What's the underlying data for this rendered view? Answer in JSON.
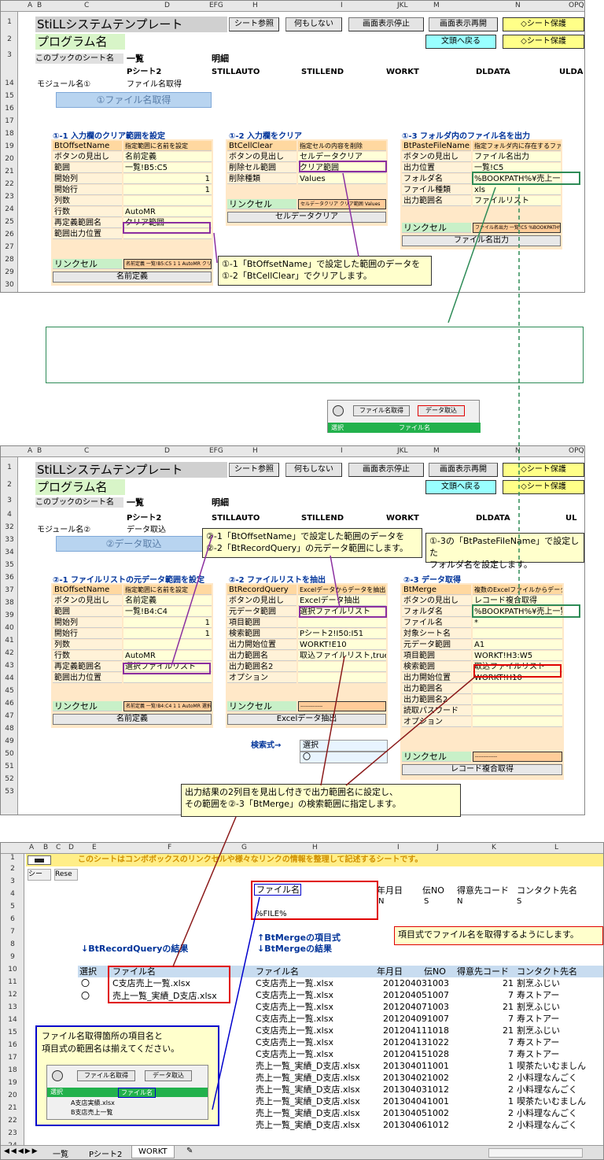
{
  "colors": {
    "accent": "#8b2fa0",
    "green": "#2e8b57",
    "red": "#e00000",
    "blue": "#0000cc"
  },
  "hdr": {
    "cols": [
      "A",
      "B",
      "C",
      "D",
      "EFG",
      "H",
      "I",
      "JKL",
      "M",
      "N",
      "OPQ"
    ],
    "title": "StiLLシステムテンプレート",
    "prog": "プログラム名",
    "btn_sheet": "シート参照",
    "btn_none": "何もしない",
    "btn_stop": "画面表示停止",
    "btn_resume": "画面表示再開",
    "btn_protect": "◇シート保護",
    "btn_back": "文頭へ戻る",
    "r3_label": "このブックのシート名",
    "r3_a": "一覧",
    "r3_b": "明細",
    "r4": [
      "Pシート2",
      "STILLAUTO",
      "STILLEND",
      "WORKT",
      "DLDATA",
      "ULDA"
    ],
    "r4b": [
      "Pシート2",
      "STILLAUTO",
      "STILLEND",
      "WORKT",
      "DLDATA",
      "UL"
    ]
  },
  "s1": {
    "rows": [
      "1",
      "2",
      "3",
      "14",
      "15",
      "16",
      "17",
      "18",
      "19",
      "20",
      "21",
      "22",
      "23",
      "24",
      "25",
      "26",
      "27",
      "28",
      "29",
      "30",
      "31"
    ],
    "module_label": "モジュール名①",
    "module_value": "ファイル名取得",
    "band": "①ファイル名取得",
    "sec1": "①-1 入力欄のクリア範囲を設定",
    "sec2": "①-2 入力欄をクリア",
    "sec3": "①-3 フォルダ内のファイル名を出力",
    "p1": [
      [
        "BtOffsetName",
        "指定範囲に名前を設定"
      ],
      [
        "ボタンの見出し",
        "名前定義"
      ],
      [
        "範囲",
        "一覧!B5:C5"
      ],
      [
        "開始列",
        "1"
      ],
      [
        "開始行",
        "1"
      ],
      [
        "列数",
        ""
      ],
      [
        "行数",
        "AutoMR"
      ],
      [
        "再定義範囲名",
        "クリア範囲"
      ],
      [
        "範囲出力位置",
        ""
      ]
    ],
    "p1_link": "リンクセル",
    "p1_linkv": "名前定義 一覧!B5:C5 1 1 AutoMR クリア範囲",
    "p1_btn": "名前定義",
    "p2": [
      [
        "BtCellClear",
        "指定セルの内容を削除"
      ],
      [
        "ボタンの見出し",
        "セルデータクリア"
      ],
      [
        "削除セル範囲",
        "クリア範囲"
      ],
      [
        "削除種類",
        "Values"
      ]
    ],
    "p2_link": "リンクセル",
    "p2_linkv": "セルデータクリア クリア範囲 Values",
    "p2_btn": "セルデータクリア",
    "p3": [
      [
        "BtPasteFileName",
        "指定フォルダ内に存在するファイル名をセルに出力"
      ],
      [
        "ボタンの見出し",
        "ファイル名出力"
      ],
      [
        "出力位置",
        "一覧!C5"
      ],
      [
        "フォルダ名",
        "%BOOKPATH%¥売上一覧"
      ],
      [
        "ファイル種類",
        "xls"
      ],
      [
        "出力範囲名",
        "ファイルリスト"
      ]
    ],
    "p3_link": "リンクセル",
    "p3_linkv": "ファイル名出力 一覧!C5 %BOOKPATH%売上一覧 xls",
    "p3_btn": "ファイル名出力",
    "callout": [
      "①-1「BtOffsetName」で設定した範囲のデータを",
      "①-2「BtCellClear」でクリアします。"
    ]
  },
  "mini": {
    "btn1": "ファイル名取得",
    "btn2": "データ取込",
    "h1": "選択",
    "h2": "ファイル名"
  },
  "s2": {
    "rows": [
      "1",
      "2",
      "3",
      "4",
      "32",
      "33",
      "34",
      "35",
      "36",
      "37",
      "38",
      "39",
      "40",
      "41",
      "42",
      "43",
      "44",
      "45",
      "46",
      "47",
      "48",
      "49",
      "50",
      "51",
      "52",
      "53"
    ],
    "module_label": "モジュール名②",
    "module_value": "データ取込",
    "band": "②データ取込",
    "sec1": "②-1 ファイルリストの元データ範囲を設定",
    "sec2": "②-2 ファイルリストを抽出",
    "sec3": "②-3 データ取得",
    "p1": [
      [
        "BtOffsetName",
        "指定範囲に名前を設定"
      ],
      [
        "ボタンの見出し",
        "名前定義"
      ],
      [
        "範囲",
        "一覧!B4:C4"
      ],
      [
        "開始列",
        "1"
      ],
      [
        "開始行",
        "1"
      ],
      [
        "列数",
        ""
      ],
      [
        "行数",
        "AutoMR"
      ],
      [
        "再定義範囲名",
        "選択ファイルリスト"
      ],
      [
        "範囲出力位置",
        ""
      ]
    ],
    "p1_link": "リンクセル",
    "p1_linkv": "名前定義 一覧!B4:C4 1 1 AutoMR 選択ファイルリスト",
    "p1_btn": "名前定義",
    "p2": [
      [
        "BtRecordQuery",
        "Excelデータからデータを抽出"
      ],
      [
        "ボタンの見出し",
        "Excelデータ抽出"
      ],
      [
        "元データ範囲",
        "選択ファイルリスト"
      ],
      [
        "項目範囲",
        ""
      ],
      [
        "検索範囲",
        "Pシート2!I50:I51"
      ],
      [
        "出力開始位置",
        "WORKT!E10"
      ],
      [
        "出力範囲名",
        "取込ファイルリスト,true,2,2"
      ],
      [
        "出力範囲名2",
        ""
      ],
      [
        "オプション",
        ""
      ]
    ],
    "p2_link": "リンクセル",
    "p2_linkv": "-------------",
    "p2_btn": "Excelデータ抽出",
    "search_label": "検索式→",
    "search_v1": "選択",
    "search_v2": "〇",
    "p3": [
      [
        "BtMerge",
        "複数のExcelファイルからデータを取得"
      ],
      [
        "ボタンの見出し",
        "レコード複合取得"
      ],
      [
        "フォルダ名",
        "%BOOKPATH%¥売上一覧"
      ],
      [
        "ファイル名",
        "*"
      ],
      [
        "対象シート名",
        ""
      ],
      [
        "元データ範囲",
        "A1"
      ],
      [
        "項目範囲",
        "WORKT!H3:W5"
      ],
      [
        "検索範囲",
        "取込ファイルリスト"
      ],
      [
        "出力開始位置",
        "WORKT!H10"
      ],
      [
        "出力範囲名",
        ""
      ],
      [
        "出力範囲名2",
        ""
      ],
      [
        "読取パスワード",
        ""
      ],
      [
        "オプション",
        ""
      ]
    ],
    "p3_link": "リンクセル",
    "p3_linkv": "-------------",
    "p3_btn": "レコード複合取得",
    "callout1": [
      "②-1「BtOffsetName」で設定した範囲のデータを",
      "②-2「BtRecordQuery」の元データ範囲にします。"
    ],
    "callout2": [
      "①-3の「BtPasteFileName」で設定した",
      "フォルダ名を設定します。"
    ]
  },
  "mid_callout": [
    "出力結果の2列目を見出し付きで出力範囲名に設定し、",
    "その範囲を②-3「BtMerge」の検索範囲に指定します。"
  ],
  "s3": {
    "cols": [
      "A",
      "B",
      "C",
      "D",
      "E",
      "F",
      "G",
      "H",
      "I",
      "J",
      "K",
      "L"
    ],
    "rows": [
      "1",
      "2",
      "3",
      "4",
      "5",
      "6",
      "7",
      "8",
      "9",
      "10",
      "11",
      "12",
      "13",
      "14",
      "15",
      "16",
      "17",
      "18",
      "19",
      "20",
      "21",
      "22",
      "23",
      "24"
    ],
    "banner": "このシートはコンボボックスのリンクセルや様々なリンクの情報を整理して記述するシートです。",
    "r2a": "シー",
    "r2b": "Rese",
    "item_hdr": [
      "ファイル名",
      "年月日",
      "伝NO",
      "得意先コード",
      "コンタクト先名"
    ],
    "item_r4": [
      "N",
      "S",
      "N",
      "S"
    ],
    "item_r5": "%FILE%",
    "callout_item": "項目式でファイル名を取得するようにします。",
    "lbl_rq": "↓BtRecordQueryの結果",
    "lbl_m1": "↑BtMergeの項目式",
    "lbl_m2": "↓BtMergeの結果",
    "rq_hdr": [
      "選択",
      "ファイル名"
    ],
    "rq_rows": [
      [
        "〇",
        "C支店売上一覧.xlsx"
      ],
      [
        "〇",
        "売上一覧_実績_D支店.xlsx"
      ]
    ],
    "res_hdr": [
      "ファイル名",
      "年月日",
      "伝NO",
      "得意先コード",
      "コンタクト先名"
    ],
    "res_rows": [
      [
        "C支店売上一覧.xlsx",
        "20120403",
        "1003",
        "21",
        "割烹ふじい"
      ],
      [
        "C支店売上一覧.xlsx",
        "20120405",
        "1007",
        "7",
        "寿ストアー"
      ],
      [
        "C支店売上一覧.xlsx",
        "20120407",
        "1003",
        "21",
        "割烹ふじい"
      ],
      [
        "C支店売上一覧.xlsx",
        "20120409",
        "1007",
        "7",
        "寿ストアー"
      ],
      [
        "C支店売上一覧.xlsx",
        "20120411",
        "1018",
        "21",
        "割烹ふじい"
      ],
      [
        "C支店売上一覧.xlsx",
        "20120413",
        "1022",
        "7",
        "寿ストアー"
      ],
      [
        "C支店売上一覧.xlsx",
        "20120415",
        "1028",
        "7",
        "寿ストアー"
      ],
      [
        "売上一覧_実績_D支店.xlsx",
        "20130401",
        "1001",
        "1",
        "喫茶たいむましん"
      ],
      [
        "売上一覧_実績_D支店.xlsx",
        "20130402",
        "1002",
        "2",
        "小料理なんごく"
      ],
      [
        "売上一覧_実績_D支店.xlsx",
        "20130403",
        "1012",
        "2",
        "小料理なんごく"
      ],
      [
        "売上一覧_実績_D支店.xlsx",
        "20130404",
        "1001",
        "1",
        "喫茶たいむましん"
      ],
      [
        "売上一覧_実績_D支店.xlsx",
        "20130405",
        "1002",
        "2",
        "小料理なんごく"
      ],
      [
        "売上一覧_実績_D支店.xlsx",
        "20130406",
        "1012",
        "2",
        "小料理なんごく"
      ]
    ],
    "callout_blue": [
      "ファイル名取得箇所の項目名と",
      "項目式の範囲名は揃えてください。"
    ],
    "blue_mini": {
      "btn1": "ファイル名取得",
      "btn2": "データ取込",
      "h1": "選択",
      "h2": "ファイル名",
      "r1": "A支店実績.xlsx",
      "r2": "B支店売上一覧"
    },
    "tabs": [
      "一覧",
      "Pシート2",
      "WORKT"
    ]
  }
}
